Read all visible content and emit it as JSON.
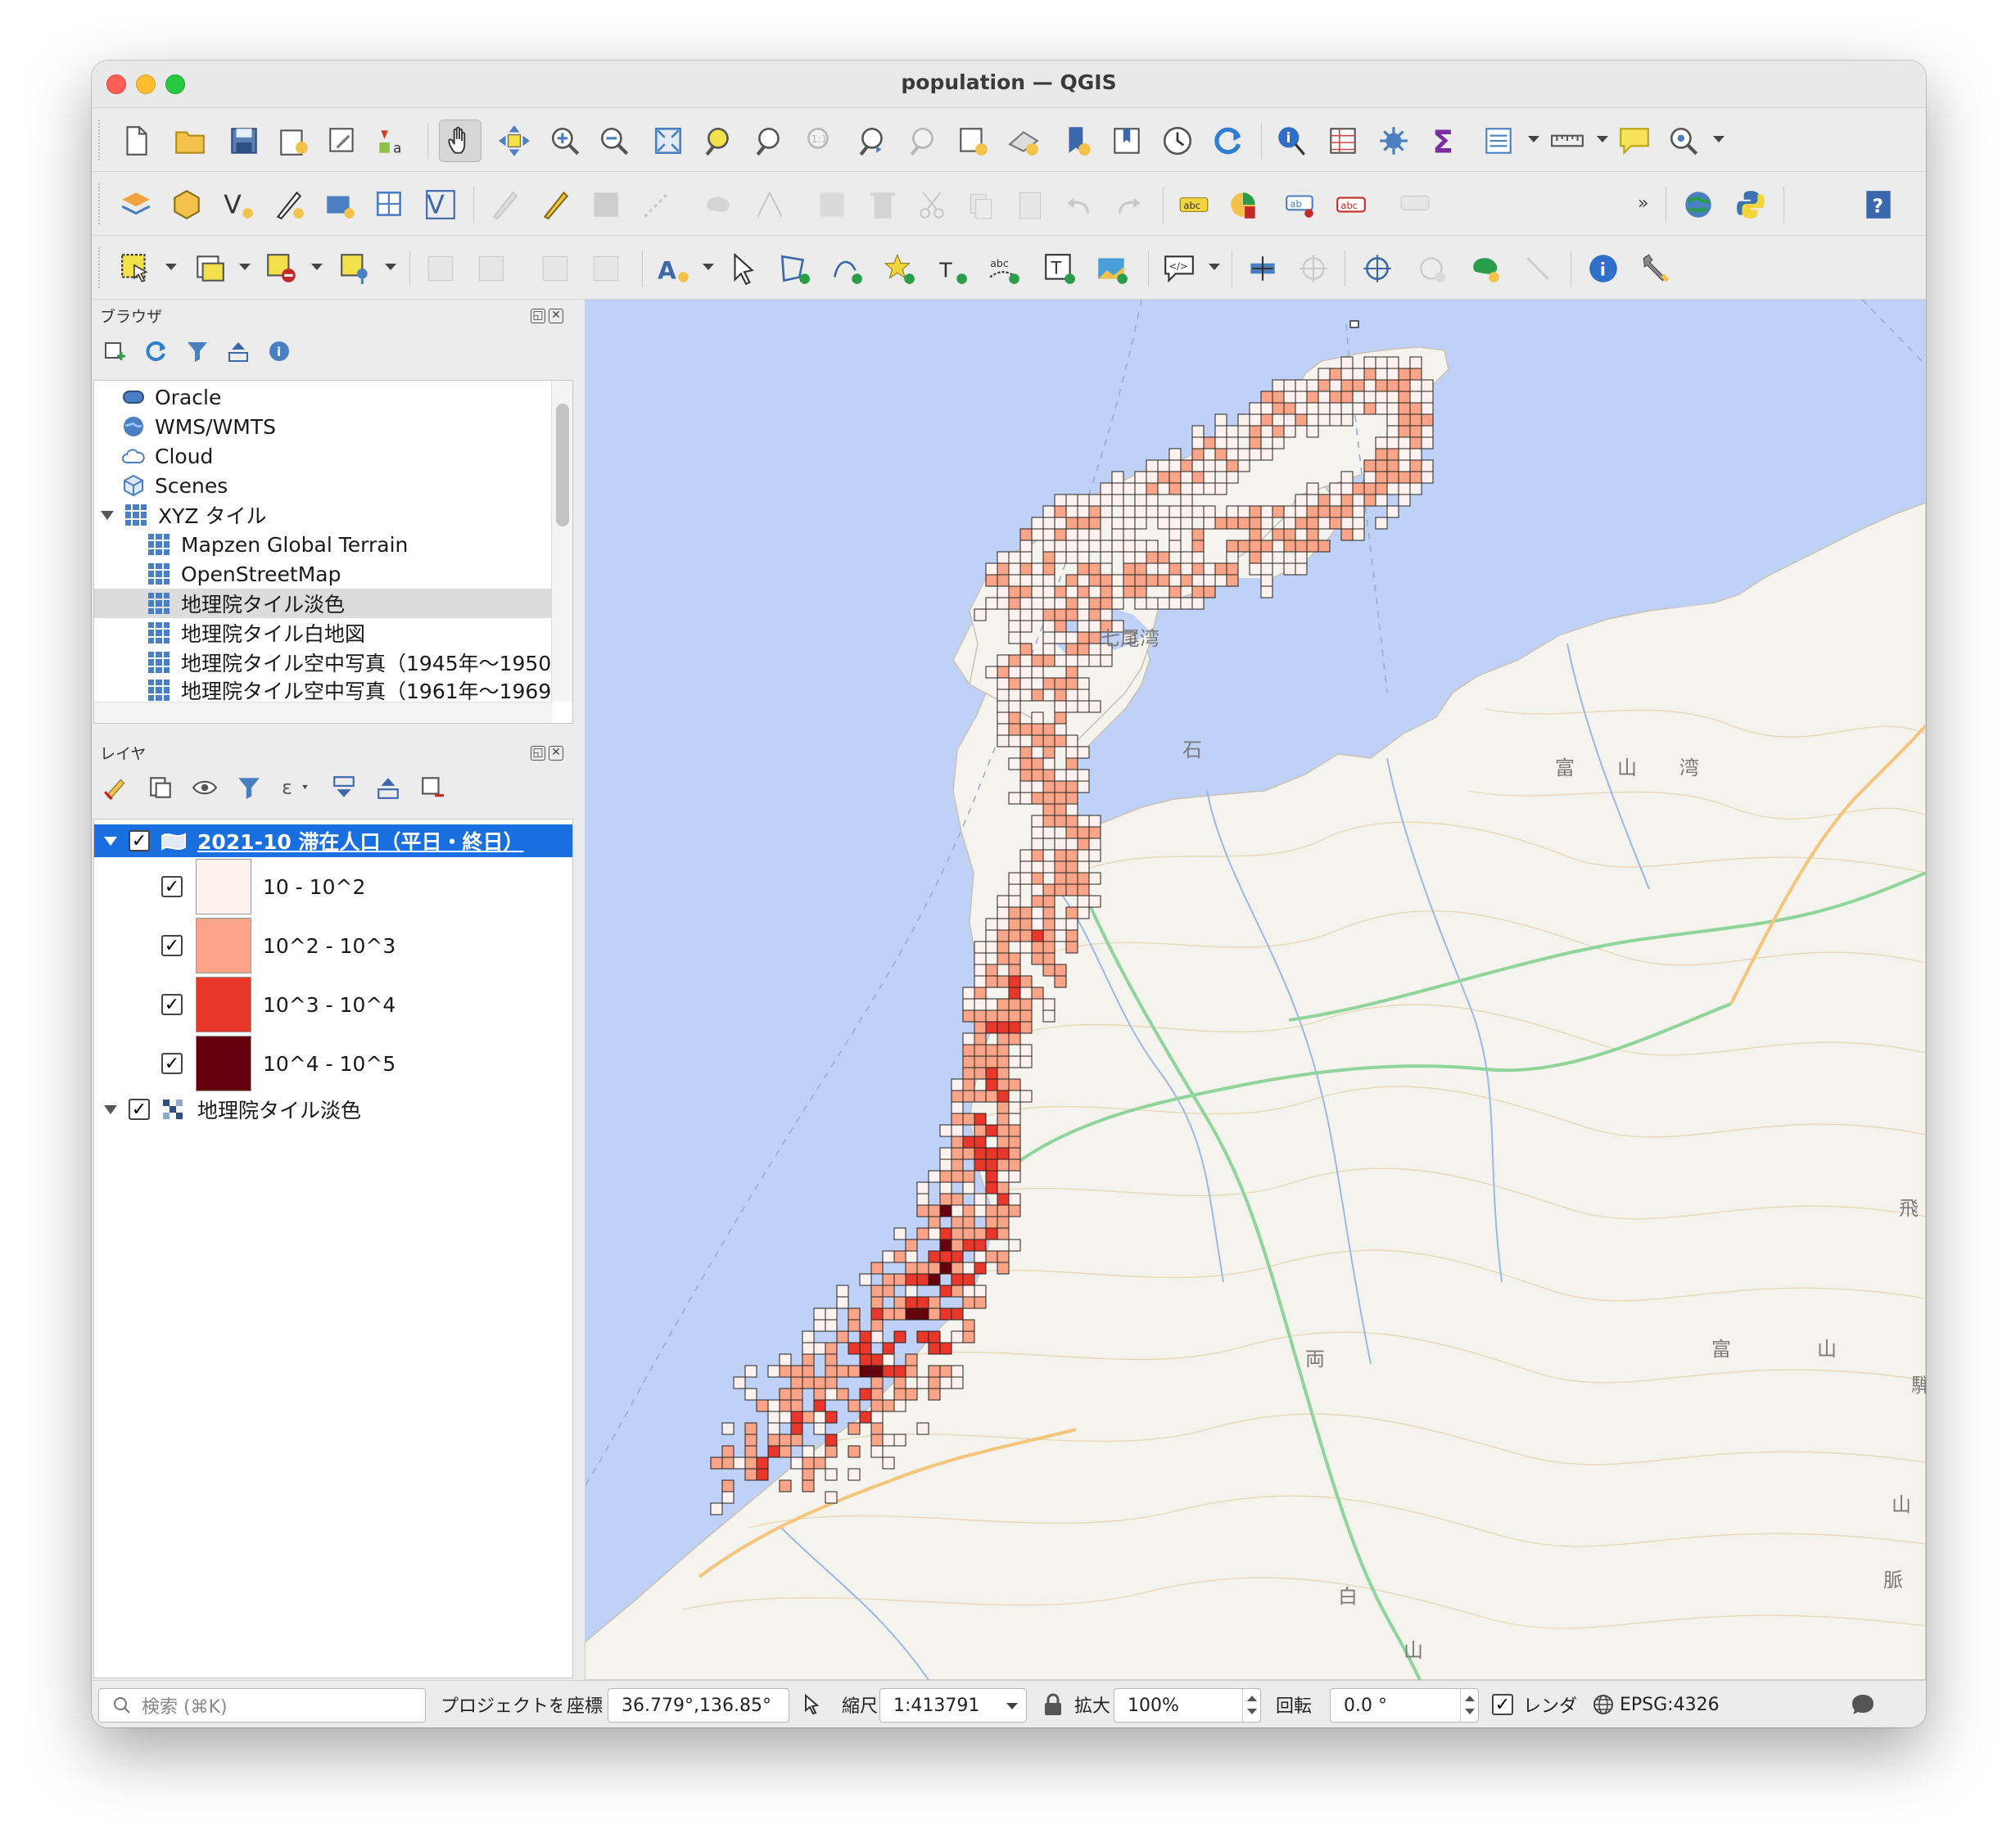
{
  "window": {
    "title": "population — QGIS"
  },
  "toolbar_icons": {
    "row1": [
      "new-project-icon",
      "open-project-icon",
      "save-project-icon",
      "print-layout-icon",
      "layout-manager-icon",
      "style-manager-icon",
      "pan-icon",
      "pan-to-selection-icon",
      "zoom-in-icon",
      "zoom-out-icon",
      "zoom-full-icon",
      "zoom-to-selection-icon",
      "zoom-to-layer-icon",
      "zoom-native-icon",
      "zoom-last-icon",
      "zoom-next-icon",
      "new-map-view-icon",
      "new-3d-view-icon",
      "bookmark-icon",
      "show-bookmarks-icon",
      "temporal-controller-icon",
      "refresh-icon",
      "identify-icon",
      "attribute-table-icon",
      "processing-toolbox-icon",
      "statistics-icon",
      "open-field-calculator-icon",
      "measure-icon",
      "map-tips-icon",
      "select-by-location-icon"
    ],
    "row2_more": "»"
  },
  "browser_panel": {
    "title": "ブラウザ",
    "items": [
      {
        "label": "Oracle",
        "icon": "oracle-icon"
      },
      {
        "label": "WMS/WMTS",
        "icon": "wms-icon"
      },
      {
        "label": "Cloud",
        "icon": "cloud-icon"
      },
      {
        "label": "Scenes",
        "icon": "scenes-icon"
      },
      {
        "label": "XYZ タイル",
        "icon": "xyz-tile-icon"
      },
      {
        "label": "Mapzen Global Terrain",
        "icon": "xyz-tile-icon"
      },
      {
        "label": "OpenStreetMap",
        "icon": "xyz-tile-icon"
      },
      {
        "label": "地理院タイル淡色",
        "icon": "xyz-tile-icon"
      },
      {
        "label": "地理院タイル白地図",
        "icon": "xyz-tile-icon"
      },
      {
        "label": "地理院タイル空中写真（1945年～1950",
        "icon": "xyz-tile-icon"
      },
      {
        "label": "地理院タイル空中写真（1961年～1969",
        "icon": "xyz-tile-icon"
      }
    ]
  },
  "layers_panel": {
    "title": "レイヤ",
    "layer1": {
      "name": "2021-10 滞在人口（平日・終日）"
    },
    "legend": [
      {
        "label": "10 - 10^2",
        "color": "#fff2ee"
      },
      {
        "label": "10^2 - 10^3",
        "color": "#fca487"
      },
      {
        "label": "10^3 - 10^4",
        "color": "#e8372a"
      },
      {
        "label": "10^4 - 10^5",
        "color": "#67000d"
      }
    ],
    "layer2": {
      "name": "地理院タイル淡色"
    }
  },
  "map_labels": {
    "sea_label": "七尾湾",
    "bay_label": "富　山　湾",
    "pref_ishi": "石",
    "region_ryo": "両",
    "region_haku": "白",
    "region_yama": "山",
    "region_tomi": "富",
    "region_yama2": "山",
    "region_hi": "飛",
    "region_hida": "騨",
    "region_myaku": "脈",
    "region_san": "山"
  },
  "status_bar": {
    "search_placeholder": "検索 (⌘K)",
    "message": "プロジェクトを保存しま",
    "coord_label": "座標",
    "coord_value": "36.779°,136.85°",
    "scale_label": "縮尺",
    "scale_value": "1:413791",
    "magnifier_label": "拡大",
    "magnifier_value": "100%",
    "rotation_label": "回転",
    "rotation_value": "0.0 °",
    "render_label": "レンダ",
    "crs": "EPSG:4326"
  },
  "colors": {
    "selection_blue": "#1a6fe0",
    "sea": "#bfd1f7",
    "land": "#f5f3ee"
  }
}
